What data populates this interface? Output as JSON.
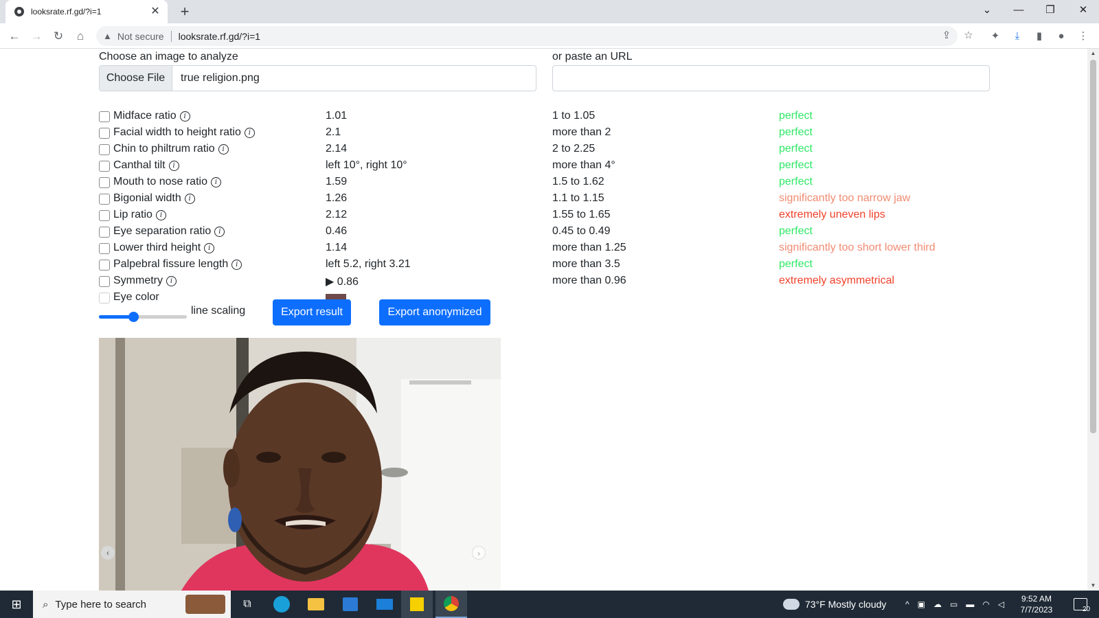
{
  "browser": {
    "tab_title": "looksrate.rf.gd/?i=1",
    "tab_close": "✕",
    "new_tab": "+",
    "not_secure": "Not secure",
    "url": "looksrate.rf.gd/?i=1"
  },
  "upload": {
    "label": "Choose an image to analyze",
    "choose_button": "Choose File",
    "file_name": "true religion.png",
    "url_label": "or paste an URL",
    "url_value": ""
  },
  "metrics": [
    {
      "name": "Midface ratio",
      "info": true,
      "value": "1.01",
      "ideal": "1 to 1.05",
      "verdict": "perfect",
      "status": "good"
    },
    {
      "name": "Facial width to height ratio",
      "info": true,
      "value": "2.1",
      "ideal": "more than 2",
      "verdict": "perfect",
      "status": "good"
    },
    {
      "name": "Chin to philtrum ratio",
      "info": true,
      "value": "2.14",
      "ideal": "2 to 2.25",
      "verdict": "perfect",
      "status": "good"
    },
    {
      "name": "Canthal tilt",
      "info": true,
      "value": "left 10°, right 10°",
      "ideal": "more than 4°",
      "verdict": "perfect",
      "status": "good"
    },
    {
      "name": "Mouth to nose ratio",
      "info": true,
      "value": "1.59",
      "ideal": "1.5 to 1.62",
      "verdict": "perfect",
      "status": "good"
    },
    {
      "name": "Bigonial width",
      "info": true,
      "value": "1.26",
      "ideal": "1.1 to 1.15",
      "verdict": "significantly too narrow jaw",
      "status": "warn"
    },
    {
      "name": "Lip ratio",
      "info": true,
      "value": "2.12",
      "ideal": "1.55 to 1.65",
      "verdict": "extremely uneven lips",
      "status": "bad"
    },
    {
      "name": "Eye separation ratio",
      "info": true,
      "value": "0.46",
      "ideal": "0.45 to 0.49",
      "verdict": "perfect",
      "status": "good"
    },
    {
      "name": "Lower third height",
      "info": true,
      "value": "1.14",
      "ideal": "more than 1.25",
      "verdict": "significantly too short lower third",
      "status": "warn"
    },
    {
      "name": "Palpebral fissure length",
      "info": true,
      "value": "left 5.2, right 3.21",
      "ideal": "more than 3.5",
      "verdict": "perfect",
      "status": "good"
    },
    {
      "name": "Symmetry",
      "info": true,
      "value": "▶ 0.86",
      "ideal": "more than 0.96",
      "verdict": "extremely asymmetrical",
      "status": "bad"
    },
    {
      "name": "Eye color",
      "info": false,
      "value": "",
      "ideal": "",
      "verdict": "",
      "status": ""
    }
  ],
  "controls": {
    "slider_label": "line scaling",
    "slider_level": 0.39,
    "export_result": "Export result",
    "export_anonymized": "Export anonymized"
  },
  "carousel": {
    "prev": "‹",
    "next": "›"
  },
  "colors": {
    "good": "#2ee866",
    "warn": "#f08b72",
    "bad": "#f0412a",
    "primary": "#0d6efd"
  },
  "taskbar": {
    "search_placeholder": "Type here to search",
    "weather": "73°F  Mostly cloudy",
    "time": "9:52 AM",
    "date": "7/7/2023",
    "notifications": "20"
  }
}
